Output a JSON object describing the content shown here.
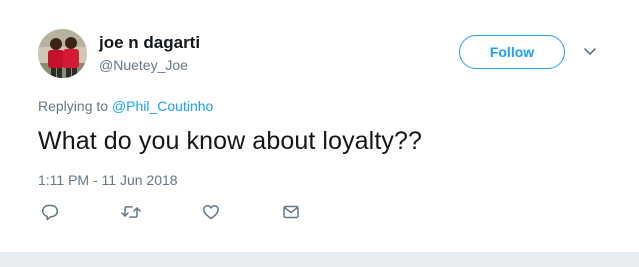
{
  "tweet": {
    "author_name": "joe n dagarti",
    "author_handle": "@Nuetey_Joe",
    "follow_label": "Follow",
    "replying_prefix": "Replying to",
    "replying_to": "@Phil_Coutinho",
    "text": "What do you know about loyalty??",
    "timestamp": "1:11 PM - 11 Jun 2018"
  },
  "actions": [
    "reply-icon",
    "retweet-icon",
    "like-icon",
    "direct-message-icon"
  ],
  "colors": {
    "accent": "#1da1f2",
    "text_primary": "#14171a",
    "text_secondary": "#657786",
    "icon": "#657786",
    "background_strip": "#e6ecf0"
  }
}
